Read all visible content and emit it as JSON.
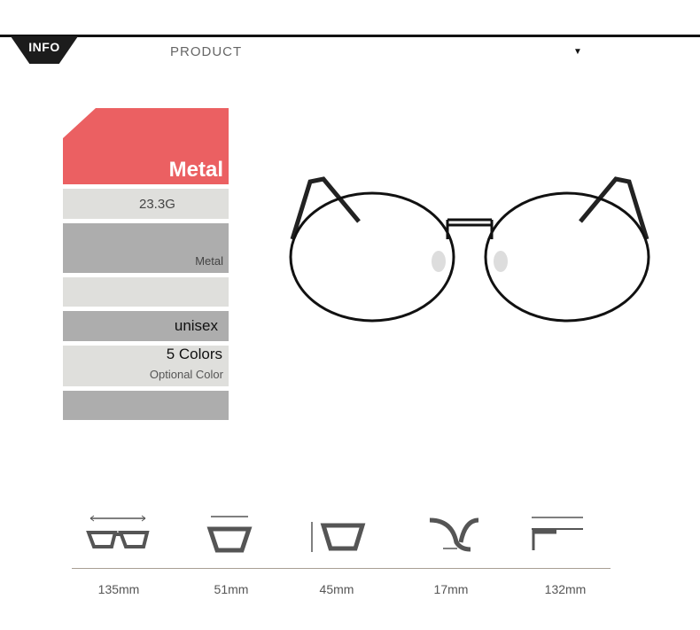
{
  "header": {
    "badge": "INFO",
    "title": "PRODUCT",
    "dropdown_icon": "triangle-down-icon"
  },
  "specs": {
    "material_title": "Metal",
    "weight": "23.3G",
    "frame_material": "Metal",
    "gender": "unisex",
    "colors": "5 Colors",
    "colors_note": "Optional Color"
  },
  "colors": {
    "accent": "#eb6062",
    "light_row": "#dfdfdc",
    "dark_row": "#adadad"
  },
  "dimensions": [
    {
      "icon": "total-width-icon",
      "value": "135mm"
    },
    {
      "icon": "lens-width-icon",
      "value": "51mm"
    },
    {
      "icon": "lens-height-icon",
      "value": "45mm"
    },
    {
      "icon": "bridge-width-icon",
      "value": "17mm"
    },
    {
      "icon": "temple-length-icon",
      "value": "132mm"
    }
  ]
}
